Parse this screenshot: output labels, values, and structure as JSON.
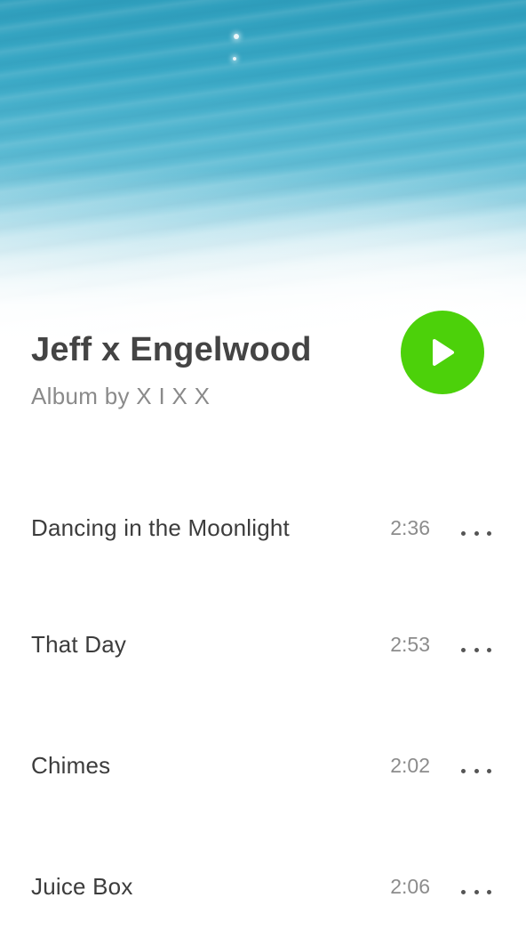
{
  "album": {
    "title": "Jeff x Engelwood",
    "subtitle": "Album by  X I X X"
  },
  "colors": {
    "play_button": "#4cd10a",
    "title_text": "#444444",
    "subtitle_text": "#8a8a8a"
  },
  "icons": {
    "play": "play-triangle-icon",
    "more": "more-horizontal-icon"
  },
  "tracks": [
    {
      "title": "Dancing in the Moonlight",
      "duration": "2:36"
    },
    {
      "title": "That Day",
      "duration": "2:53"
    },
    {
      "title": "Chimes",
      "duration": "2:02"
    },
    {
      "title": "Juice Box",
      "duration": "2:06"
    }
  ]
}
